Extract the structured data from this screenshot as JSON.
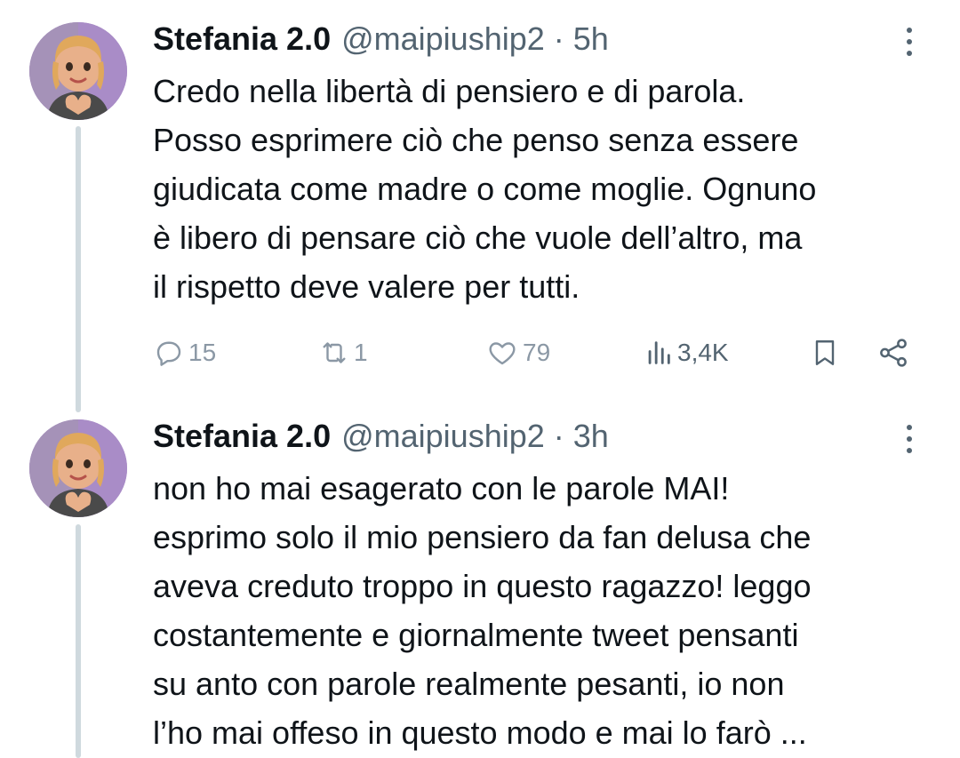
{
  "tweets": [
    {
      "author_name": "Stefania 2.0",
      "handle": "@maipiuship2",
      "separator": "·",
      "time": "5h",
      "text": "Credo nella libertà di pensiero e di parola.\nPosso esprimere ciò che penso senza essere\ngiudicata come madre o come moglie. Ognuno\nè libero di pensare ciò che vuole dell’altro, ma\nil rispetto deve valere per tutti.",
      "replies": "15",
      "retweets": "1",
      "likes": "79",
      "views": "3,4K"
    },
    {
      "author_name": "Stefania 2.0",
      "handle": "@maipiuship2",
      "separator": "·",
      "time": "3h",
      "text": "non ho mai esagerato con le parole MAI!\nesprimo solo il mio pensiero da fan delusa che\naveva creduto troppo in questo ragazzo! leggo\ncostantemente e giornalmente tweet pensanti\nsu anto con parole realmente pesanti, io non\nl’ho mai offeso in questo modo e mai lo farò ..."
    }
  ],
  "icons": {
    "reply": "reply-icon",
    "retweet": "retweet-icon",
    "like": "like-icon",
    "views": "views-icon",
    "bookmark": "bookmark-icon",
    "share": "share-icon",
    "more": "more-icon"
  },
  "colors": {
    "text_primary": "#0f1419",
    "text_secondary": "#536471",
    "thread_line": "#cfd9de",
    "avatar_bg": "#a98cc7"
  }
}
